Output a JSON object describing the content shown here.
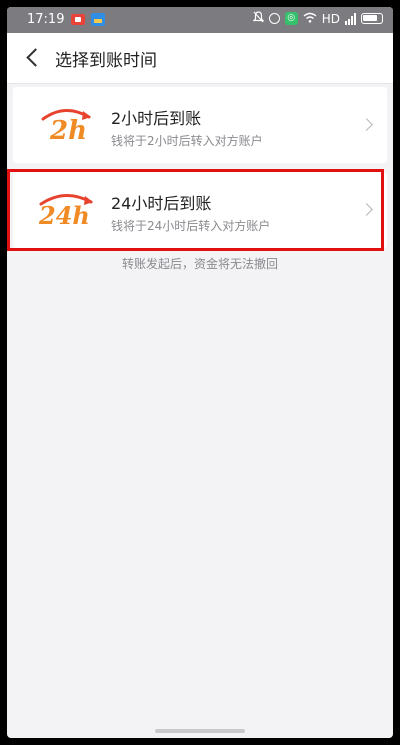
{
  "status_bar": {
    "time": "17:19",
    "network_label": "HD",
    "notification_icons": [
      "video-notification-icon",
      "app-notification-icon"
    ],
    "system_icons": [
      "bell-off-icon",
      "alarm-icon",
      "green-app-icon",
      "wifi-icon",
      "signal-icon",
      "battery-icon"
    ]
  },
  "navbar": {
    "back_icon": "chevron-left-icon",
    "title": "选择到账时间"
  },
  "options": [
    {
      "logo_text": "2h",
      "title": "2小时后到账",
      "subtitle": "钱将于2小时后转入对方账户",
      "highlighted": false
    },
    {
      "logo_text": "24h",
      "title": "24小时后到账",
      "subtitle": "钱将于24小时后转入对方账户",
      "highlighted": true
    }
  ],
  "note": "转账发起后，资金将无法撤回",
  "colors": {
    "logo_orange": "#f08a24",
    "logo_red": "#e8432f",
    "highlight": "#e21010",
    "background": "#f3f3f6"
  }
}
